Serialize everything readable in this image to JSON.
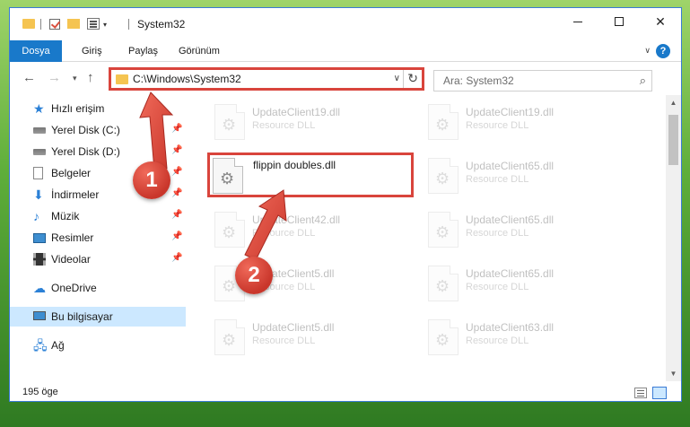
{
  "window": {
    "title": "System32"
  },
  "ribbon": {
    "tabs": [
      "Dosya",
      "Giriş",
      "Paylaş",
      "Görünüm"
    ],
    "help": "?"
  },
  "nav": {
    "address": "C:\\Windows\\System32",
    "search_placeholder": "Ara: System32"
  },
  "sidebar": {
    "items": [
      {
        "label": "Hızlı erişim",
        "icon": "star-icon"
      },
      {
        "label": "Yerel Disk (C:)",
        "icon": "disk-icon",
        "pinned": true
      },
      {
        "label": "Yerel Disk (D:)",
        "icon": "disk-icon",
        "pinned": true
      },
      {
        "label": "Belgeler",
        "icon": "documents-icon",
        "pinned": true
      },
      {
        "label": "İndirmeler",
        "icon": "download-icon",
        "pinned": true
      },
      {
        "label": "Müzik",
        "icon": "music-icon",
        "pinned": true
      },
      {
        "label": "Resimler",
        "icon": "pictures-icon",
        "pinned": true
      },
      {
        "label": "Videolar",
        "icon": "video-icon",
        "pinned": true
      },
      {
        "label": "OneDrive",
        "icon": "cloud-icon"
      },
      {
        "label": "Bu bilgisayar",
        "icon": "computer-icon",
        "selected": true
      },
      {
        "label": "Ağ",
        "icon": "network-icon"
      }
    ]
  },
  "files": {
    "left": [
      {
        "name": "UpdateClient19.dll",
        "type": "Resource DLL"
      },
      {
        "name": "flippin doubles.dll",
        "type": "",
        "highlighted": true
      },
      {
        "name": "UpdateClient42.dll",
        "type": "Resource DLL"
      },
      {
        "name": "UpdateClient5.dll",
        "type": "Resource DLL"
      },
      {
        "name": "UpdateClient5.dll",
        "type": "Resource DLL"
      }
    ],
    "right": [
      {
        "name": "UpdateClient19.dll",
        "type": "Resource DLL"
      },
      {
        "name": "UpdateClient65.dll",
        "type": "Resource DLL"
      },
      {
        "name": "UpdateClient65.dll",
        "type": "Resource DLL"
      },
      {
        "name": "UpdateClient65.dll",
        "type": "Resource DLL"
      },
      {
        "name": "UpdateClient63.dll",
        "type": "Resource DLL"
      }
    ]
  },
  "status": {
    "item_count": "195 öge"
  },
  "annotations": {
    "step1": "1",
    "step2": "2"
  },
  "colors": {
    "accent": "#1979ca",
    "highlight": "#d9443c",
    "selected_bg": "#cce8ff"
  }
}
